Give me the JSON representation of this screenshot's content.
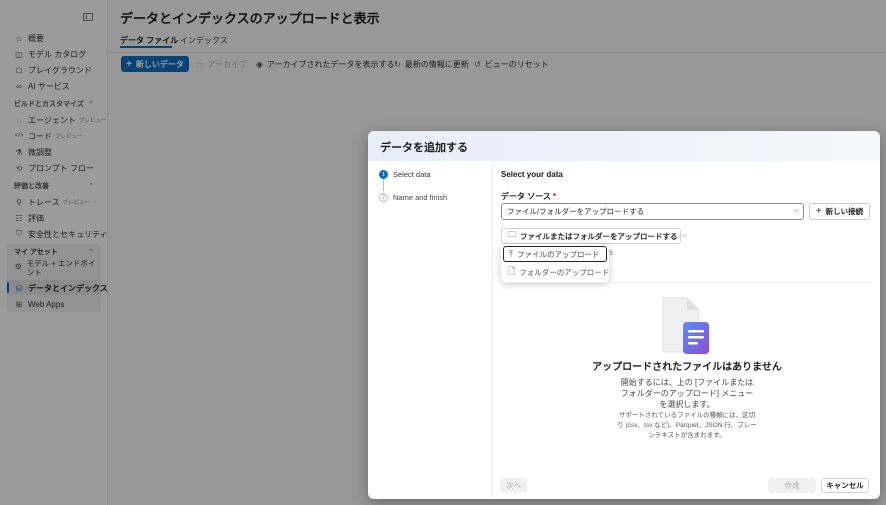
{
  "sidebar": {
    "items_top": [
      {
        "label": "概要",
        "icon": "home-icon",
        "glyph": "⌂"
      },
      {
        "label": "モデル カタログ",
        "icon": "catalog-icon",
        "glyph": "◫"
      },
      {
        "label": "プレイグラウンド",
        "icon": "playground-icon",
        "glyph": "☖"
      },
      {
        "label": "AI サービス",
        "icon": "ai-services-icon",
        "glyph": "∞"
      }
    ],
    "section_build": "ビルドとカスタマイズ",
    "items_build": [
      {
        "label": "エージェント",
        "preview": "プレビュー",
        "icon": "agent-icon",
        "glyph": "◌"
      },
      {
        "label": "コード",
        "preview": "プレビュー",
        "icon": "code-icon",
        "glyph": "</>"
      },
      {
        "label": "微調整",
        "preview": "",
        "icon": "flask-icon",
        "glyph": "⚗"
      },
      {
        "label": "プロンプト フロー",
        "preview": "",
        "icon": "flow-icon",
        "glyph": "⟲"
      }
    ],
    "section_eval": "評価と改善",
    "items_eval": [
      {
        "label": "トレース",
        "preview": "プレビュー",
        "icon": "trace-icon",
        "glyph": "⚲"
      },
      {
        "label": "評価",
        "preview": "",
        "icon": "evaluation-icon",
        "glyph": "☷"
      },
      {
        "label": "安全性とセキュリティ",
        "preview": "",
        "icon": "shield-icon",
        "glyph": "⛉"
      }
    ],
    "section_assets": "マイ アセット",
    "items_assets": [
      {
        "label": "モデル + エンドポイント",
        "icon": "model-endpoint-icon",
        "glyph": "⚙"
      },
      {
        "label": "データとインデックス",
        "icon": "database-icon",
        "glyph": "⛁"
      },
      {
        "label": "Web Apps",
        "icon": "web-apps-icon",
        "glyph": "⊞"
      }
    ]
  },
  "main": {
    "title": "データとインデックスのアップロードと表示",
    "tabs": [
      {
        "label": "データ ファイル"
      },
      {
        "label": "インデックス"
      }
    ],
    "toolbar": {
      "new_data": "新しいデータ",
      "archive": "アーカイブ",
      "show_archived": "アーカイブされたデータを表示する",
      "refresh": "最新の情報に更新",
      "reset_view": "ビューのリセット"
    }
  },
  "dialog": {
    "title": "データを追加する",
    "steps": [
      {
        "num": "1",
        "label": "Select data"
      },
      {
        "num": "2",
        "label": "Name and finish"
      }
    ],
    "section_title": "Select your data",
    "data_source_label": "データ ソース",
    "data_source_value": "ファイル/フォルダーをアップロードする",
    "new_connection": "新しい接続",
    "upload_button": "ファイルまたはフォルダーをアップロードする",
    "upload_menu": [
      {
        "label": "ファイルのアップロード"
      },
      {
        "label": "フォルダーのアップロード"
      }
    ],
    "empty_title": "アップロードされたファイルはありません",
    "empty_desc": "開始するには、上の [ファイルまたはフォルダーのアップロード] メニューを選択します。",
    "empty_note": "サポートされているファイルの種類には、区切り (csv、tsv など)、Parquet、JSON 行、プレーンテキストが含まれます。",
    "next": "次へ",
    "create": "作成",
    "cancel": "キャンセル"
  },
  "colors": {
    "accent": "#0f6cbd",
    "required": "#c50f1f"
  }
}
